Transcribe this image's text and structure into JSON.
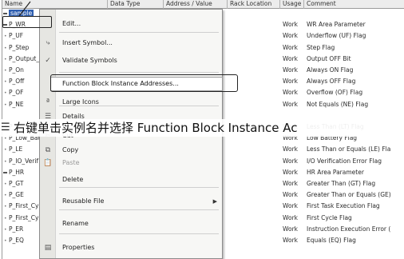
{
  "grid": {
    "columns": [
      {
        "key": "name",
        "label": "Name"
      },
      {
        "key": "type",
        "label": "Data Type"
      },
      {
        "key": "addr",
        "label": "Address / Value"
      },
      {
        "key": "rack",
        "label": "Rack Location"
      },
      {
        "key": "usage",
        "label": "Usage"
      },
      {
        "key": "comment",
        "label": "Comment"
      }
    ],
    "selected_row": "sample",
    "rows": [
      {
        "name": "sample",
        "type": "",
        "addr": "",
        "usage": "",
        "comment": "",
        "marker": "group"
      },
      {
        "name": "P_WR",
        "type": "",
        "addr": "",
        "usage": "Work",
        "comment": "WR Area Parameter",
        "marker": "group"
      },
      {
        "name": "P_UF",
        "type": "",
        "addr": "",
        "usage": "Work",
        "comment": "Underflow (UF) Flag",
        "marker": "dot"
      },
      {
        "name": "P_Step",
        "type": "",
        "addr": "",
        "usage": "Work",
        "comment": "Step Flag",
        "marker": "dot"
      },
      {
        "name": "P_Output_",
        "type": "",
        "addr": "",
        "usage": "Work",
        "comment": "Output OFF Bit",
        "marker": "dot"
      },
      {
        "name": "P_On",
        "type": "",
        "addr": "",
        "usage": "Work",
        "comment": "Always ON Flag",
        "marker": "dot"
      },
      {
        "name": "P_Off",
        "type": "",
        "addr": "",
        "usage": "Work",
        "comment": "Always OFF Flag",
        "marker": "dot"
      },
      {
        "name": "P_OF",
        "type": "",
        "addr": "",
        "usage": "Work",
        "comment": "Overflow (OF) Flag",
        "marker": "dot"
      },
      {
        "name": "P_NE",
        "type": "",
        "addr": "",
        "usage": "Work",
        "comment": "Not Equals (NE) Flag",
        "marker": "dot"
      },
      {
        "name": "",
        "type": "",
        "addr": "",
        "usage": "",
        "comment": "",
        "marker": ""
      },
      {
        "name": "P_LT",
        "type": "",
        "addr": "",
        "usage": "Work",
        "comment": "Less Than (LT) Flag",
        "marker": "dot"
      },
      {
        "name": "P_Low_Bat",
        "type": "",
        "addr": "",
        "usage": "Work",
        "comment": "Low Battery Flag",
        "marker": "dot"
      },
      {
        "name": "P_LE",
        "type": "",
        "addr": "",
        "usage": "Work",
        "comment": "Less Than or Equals (LE) Fla",
        "marker": "dot"
      },
      {
        "name": "P_IO_Verif",
        "type": "",
        "addr": "",
        "usage": "Work",
        "comment": "I/O Verification Error Flag",
        "marker": "dot"
      },
      {
        "name": "P_HR",
        "type": "",
        "addr": "",
        "usage": "Work",
        "comment": "HR Area Parameter",
        "marker": "group"
      },
      {
        "name": "P_GT",
        "type": "",
        "addr": "",
        "usage": "Work",
        "comment": "Greater Than (GT) Flag",
        "marker": "dot"
      },
      {
        "name": "P_GE",
        "type": "",
        "addr": "",
        "usage": "Work",
        "comment": "Greater Than or Equals (GE)",
        "marker": "dot"
      },
      {
        "name": "P_First_Cy",
        "type": "",
        "addr": "",
        "usage": "Work",
        "comment": "First Task Execution Flag",
        "marker": "dot"
      },
      {
        "name": "P_First_Cy",
        "type": "",
        "addr": "",
        "usage": "Work",
        "comment": "First Cycle Flag",
        "marker": "dot"
      },
      {
        "name": "P_ER",
        "type": "",
        "addr": "",
        "usage": "Work",
        "comment": "Instruction Execution Error (",
        "marker": "dot"
      },
      {
        "name": "P_EQ",
        "type": "",
        "addr": "",
        "usage": "Work",
        "comment": "Equals (EQ) Flag",
        "marker": "dot"
      }
    ]
  },
  "context_menu": {
    "items": [
      {
        "label": "Edit...",
        "icon": "edit-icon",
        "glyph": "",
        "disabled": false,
        "highlighted": false,
        "submenu": false
      },
      {
        "label": "Insert Symbol...",
        "icon": "insert-symbol-icon",
        "glyph": "⤷",
        "disabled": false,
        "highlighted": false,
        "submenu": false
      },
      {
        "label": "Validate Symbols",
        "icon": "validate-icon",
        "glyph": "✓",
        "disabled": false,
        "highlighted": false,
        "submenu": false
      },
      {
        "label": "Function Block Instance Addresses...",
        "icon": "",
        "glyph": "",
        "disabled": false,
        "highlighted": true,
        "submenu": false
      },
      {
        "label": "Large Icons",
        "icon": "large-icons-icon",
        "glyph": "ª",
        "disabled": false,
        "highlighted": false,
        "submenu": false
      },
      {
        "label": "Details",
        "icon": "details-icon",
        "glyph": "☰",
        "disabled": false,
        "highlighted": false,
        "submenu": false
      },
      {
        "label": "Cut",
        "icon": "cut-icon",
        "glyph": "✂",
        "disabled": false,
        "highlighted": false,
        "submenu": false
      },
      {
        "label": "Copy",
        "icon": "copy-icon",
        "glyph": "⧉",
        "disabled": false,
        "highlighted": false,
        "submenu": false
      },
      {
        "label": "Paste",
        "icon": "paste-icon",
        "glyph": "📋",
        "disabled": true,
        "highlighted": false,
        "submenu": false
      },
      {
        "label": "Delete",
        "icon": "",
        "glyph": "",
        "disabled": false,
        "highlighted": false,
        "submenu": false
      },
      {
        "label": "Reusable File",
        "icon": "",
        "glyph": "",
        "disabled": false,
        "highlighted": false,
        "submenu": true
      },
      {
        "label": "Rename",
        "icon": "",
        "glyph": "",
        "disabled": false,
        "highlighted": false,
        "submenu": false
      },
      {
        "label": "Properties",
        "icon": "properties-icon",
        "glyph": "▤",
        "disabled": false,
        "highlighted": false,
        "submenu": false
      }
    ]
  },
  "caption": {
    "text": "右键单击实例名并选择 Function Block Instance Ac",
    "icon": "pointer-icon",
    "glyph": "☰"
  },
  "colors": {
    "selection": "#2f5fb0",
    "menu_bg": "#f7f7f5",
    "header_bg": "#ececec"
  }
}
